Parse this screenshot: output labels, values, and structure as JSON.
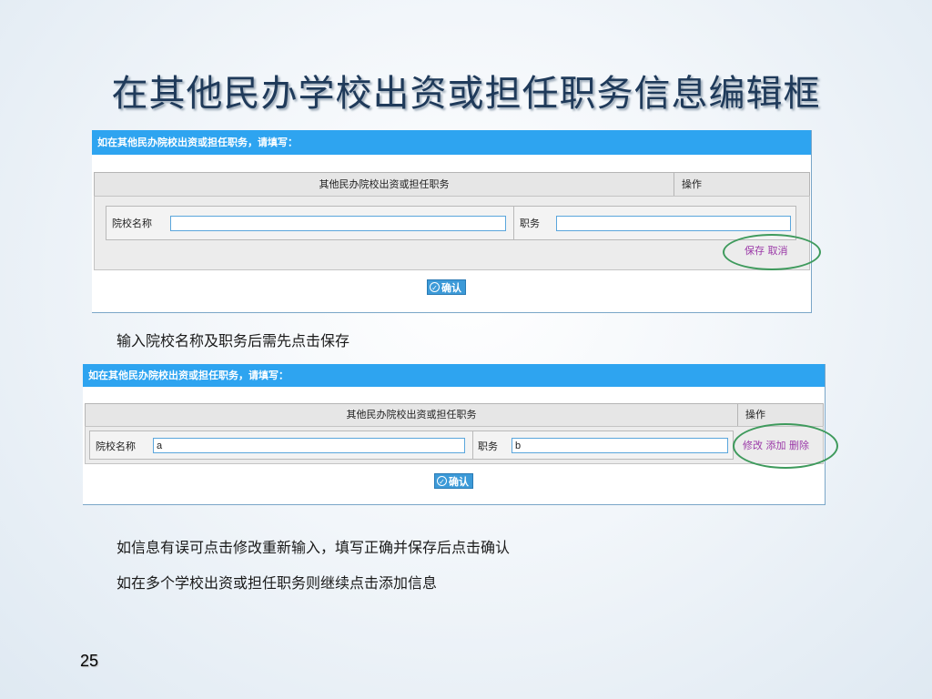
{
  "slide": {
    "title": "在其他民办学校出资或担任职务信息编辑框",
    "page_number": "25",
    "note1": "输入院校名称及职务后需先点击保存",
    "note2": "如信息有误可点击修改重新输入，填写正确并保存后点击确认",
    "note3": "如在多个学校出资或担任职务则继续点击添加信息"
  },
  "panel1": {
    "header": "如在其他民办院校出资或担任职务，请填写：",
    "col_main": "其他民办院校出资或担任职务",
    "col_action": "操作",
    "school_label": "院校名称",
    "school_value": "",
    "position_label": "职务",
    "position_value": "",
    "save": "保存",
    "cancel": "取消",
    "confirm": "确认"
  },
  "panel2": {
    "header": "如在其他民办院校出资或担任职务，请填写：",
    "col_main": "其他民办院校出资或担任职务",
    "col_action": "操作",
    "school_label": "院校名称",
    "school_value": "a",
    "position_label": "职务",
    "position_value": "b",
    "edit": "修改",
    "add": "添加",
    "delete": "删除",
    "confirm": "确认"
  },
  "colors": {
    "header_blue": "#2ea4f0",
    "link_purple": "#9b39a8",
    "highlight_green": "#3e9a5c"
  },
  "icons": {
    "confirm_icon": "check-circle-icon"
  }
}
